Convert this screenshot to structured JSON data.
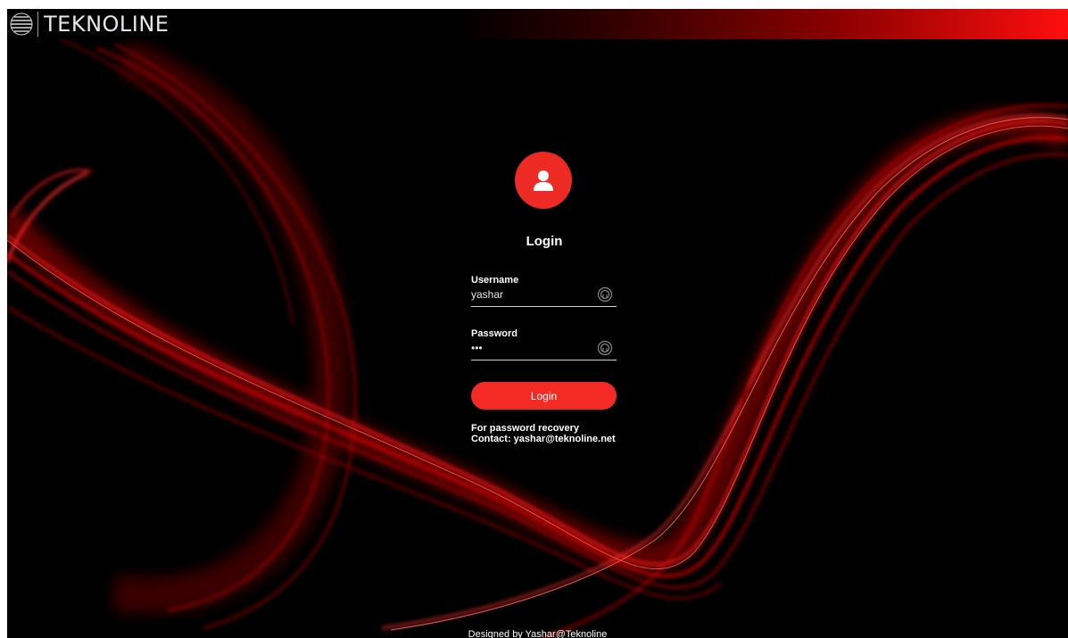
{
  "brand": {
    "name": "TEKNOLINE",
    "logo_icon": "striped-globe-icon"
  },
  "login": {
    "title": "Login",
    "avatar_icon": "user-icon",
    "username": {
      "label": "Username",
      "value": "yashar",
      "icon": "fingerprint-icon"
    },
    "password": {
      "label": "Password",
      "value": "•••",
      "icon": "fingerprint-icon"
    },
    "submit_label": "Login",
    "recovery_line1": "For password recovery",
    "recovery_line2": "Contact: yashar@teknoline.net"
  },
  "footer": {
    "text": "Designed by Yashar@Teknoline"
  },
  "colors": {
    "accent": "#f42a24",
    "background": "#000000",
    "text": "#ffffff"
  }
}
